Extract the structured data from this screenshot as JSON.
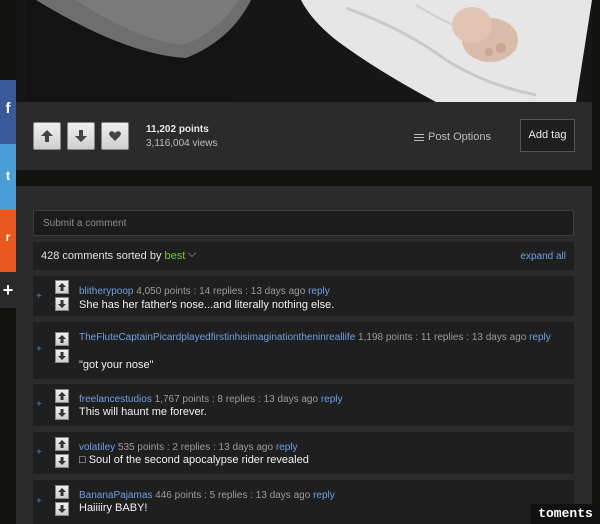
{
  "share": {
    "facebook_glyph": "f",
    "twitter_glyph": "t",
    "reddit_glyph": "r",
    "more_glyph": "+"
  },
  "post": {
    "points": "11,202 points",
    "views": "3,116,004 views",
    "post_options_label": "Post Options",
    "add_tag_label": "Add tag"
  },
  "comments_panel": {
    "submit_placeholder": "Submit a comment",
    "count_text": "428 comments sorted by",
    "sort_value": "best",
    "expand_all_label": "expand all"
  },
  "comments": [
    {
      "user": "blitherypoop",
      "stats": "4,050 points : 14 replies : 13 days ago",
      "reply": "reply",
      "text": "She has her father's nose...and literally nothing else."
    },
    {
      "user": "TheFluteCaptainPicardplayedfirstinhisimaginationtheninreallife",
      "stats": "1,198 points : 11 replies : 13 days ago",
      "reply": "reply",
      "text": "\"got your nose\""
    },
    {
      "user": "freelancestudios",
      "stats": "1,767 points : 8 replies : 13 days ago",
      "reply": "reply",
      "text": "This will haunt me forever."
    },
    {
      "user": "volatiley",
      "stats": "535 points : 2 replies : 13 days ago",
      "reply": "reply",
      "text": "□ Soul of the second apocalypse rider revealed"
    },
    {
      "user": "BananaPajamas",
      "stats": "446 points : 5 replies : 13 days ago",
      "reply": "reply",
      "text": "Haiiiiry BABY!"
    }
  ],
  "comment_plus": "+",
  "watermark": "toments",
  "colors": {
    "link": "#6fa0e2",
    "sort_accent": "#7ac143",
    "facebook": "#3b5998",
    "twitter": "#4a9dd6",
    "reddit": "#e8581f"
  }
}
